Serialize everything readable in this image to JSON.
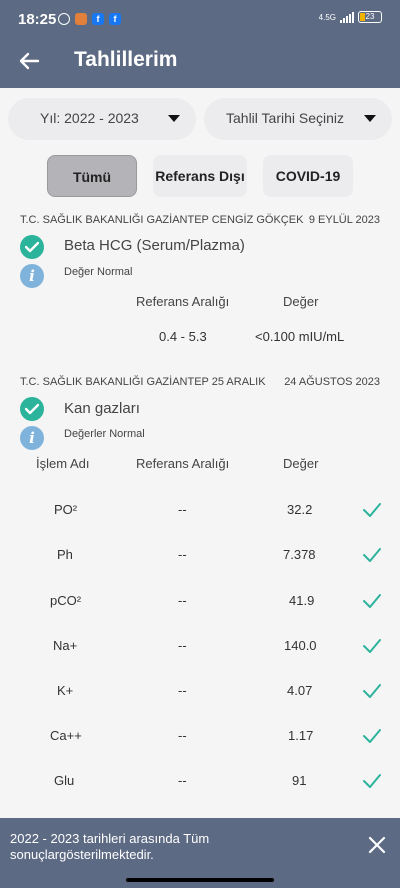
{
  "status_bar": {
    "time": "18:25",
    "network": "4.5G",
    "battery": "23"
  },
  "app_bar": {
    "title": "Tahlillerim",
    "back_icon": "arrow-left-icon"
  },
  "filters": {
    "year": "Yıl: 2022 - 2023",
    "date": "Tahlil Tarihi Seçiniz"
  },
  "tabs": [
    {
      "label": "Tümü",
      "active": true
    },
    {
      "label": "Referans Dışı",
      "active": false
    },
    {
      "label": "COVID-19",
      "active": false
    }
  ],
  "results": [
    {
      "hospital": "T.C. SAĞLIK BAKANLIĞI GAZİANTEP CENGİZ GÖKÇEK",
      "date": "9 EYLÜL 2023",
      "test_name": "Beta HCG (Serum/Plazma)",
      "note": "Değer Normal",
      "headers": {
        "range": "Referans Aralığı",
        "value": "Değer"
      },
      "range": "0.4 - 5.3",
      "value": "<0.100 mIU/mL"
    },
    {
      "hospital": "T.C. SAĞLIK BAKANLIĞI GAZİANTEP 25 ARALIK",
      "date": "24 AĞUSTOS 2023",
      "test_name": "Kan gazları",
      "note": "Değerler Normal",
      "headers": {
        "name": "İşlem Adı",
        "range": "Referans Aralığı",
        "value": "Değer"
      },
      "rows": [
        {
          "name": "PO²",
          "range": "--",
          "value": "32.2"
        },
        {
          "name": "Ph",
          "range": "--",
          "value": "7.378"
        },
        {
          "name": "pCO²",
          "range": "--",
          "value": "41.9"
        },
        {
          "name": "Na+",
          "range": "--",
          "value": "140.0"
        },
        {
          "name": "K+",
          "range": "--",
          "value": "4.07"
        },
        {
          "name": "Ca++",
          "range": "--",
          "value": "1.17"
        },
        {
          "name": "Glu",
          "range": "--",
          "value": "91"
        }
      ]
    }
  ],
  "banner": {
    "message": "2022 - 2023 tarihleri arasında Tüm sonuçlargösterilmektedir."
  },
  "colors": {
    "header": "#5d6a83",
    "accent": "#2bb39b",
    "info": "#7fb3db"
  }
}
